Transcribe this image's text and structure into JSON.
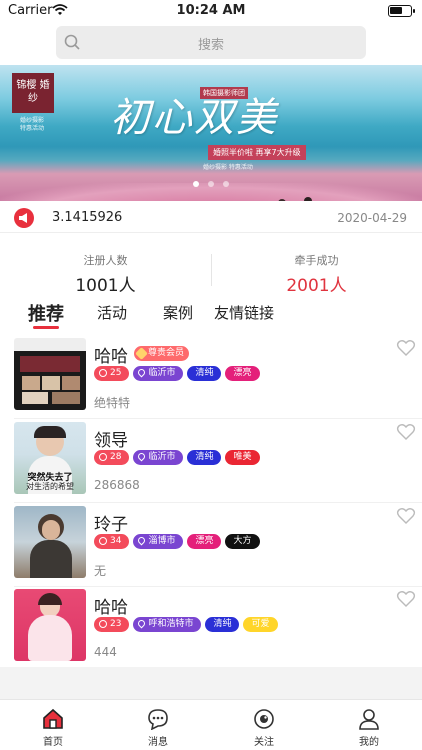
{
  "status_bar": {
    "carrier": "Carrier",
    "time": "10:24 AM"
  },
  "search": {
    "placeholder": "搜索"
  },
  "banner": {
    "logo_text": "锦樱 婚纱",
    "title": "初心双美",
    "tag_top": "韩国摄影师团",
    "tag_mid": "婚照半价啦 再享7大升级",
    "tag_sub": "婚纱摄影 特惠活动",
    "slide_count": 3,
    "active_slide": 1
  },
  "notice": {
    "text": "3.1415926",
    "date": "2020-04-29"
  },
  "stats": {
    "registered_label": "注册人数",
    "registered_value": "1001人",
    "matched_label": "牵手成功",
    "matched_value": "2001人"
  },
  "tabs": [
    {
      "label": "推荐",
      "active": true
    },
    {
      "label": "活动",
      "active": false
    },
    {
      "label": "案例",
      "active": false
    },
    {
      "label": "友情链接",
      "active": false
    }
  ],
  "users": [
    {
      "name": "哈哈",
      "vip": "尊贵会员",
      "age": "25",
      "city": "临沂市",
      "traits": [
        {
          "text": "清纯",
          "color": "blue"
        },
        {
          "text": "漂亮",
          "color": "pink"
        }
      ],
      "desc": "绝特特"
    },
    {
      "name": "领导",
      "vip": "",
      "age": "28",
      "city": "临沂市",
      "traits": [
        {
          "text": "清纯",
          "color": "blue"
        },
        {
          "text": "唯美",
          "color": "red"
        }
      ],
      "desc": "286868"
    },
    {
      "name": "玲子",
      "vip": "",
      "age": "34",
      "city": "淄博市",
      "traits": [
        {
          "text": "漂亮",
          "color": "pink"
        },
        {
          "text": "大方",
          "color": "black"
        }
      ],
      "desc": "无"
    },
    {
      "name": "哈哈",
      "vip": "",
      "age": "23",
      "city": "呼和浩特市",
      "traits": [
        {
          "text": "清纯",
          "color": "blue"
        },
        {
          "text": "可爱",
          "color": "yellow"
        }
      ],
      "desc": "444"
    }
  ],
  "thumb_texts": {
    "user2_caption_1": "突然失去了",
    "user2_caption_2": "对生活的希望"
  },
  "tabbar": [
    {
      "label": "首页",
      "icon": "home-icon",
      "active": true
    },
    {
      "label": "消息",
      "icon": "message-icon",
      "active": false
    },
    {
      "label": "关注",
      "icon": "eye-icon",
      "active": false
    },
    {
      "label": "我的",
      "icon": "user-icon",
      "active": false
    }
  ],
  "colors": {
    "accent": "#e8303d",
    "vip": "#fe6a6c",
    "city_tag": "#7a45d1"
  }
}
